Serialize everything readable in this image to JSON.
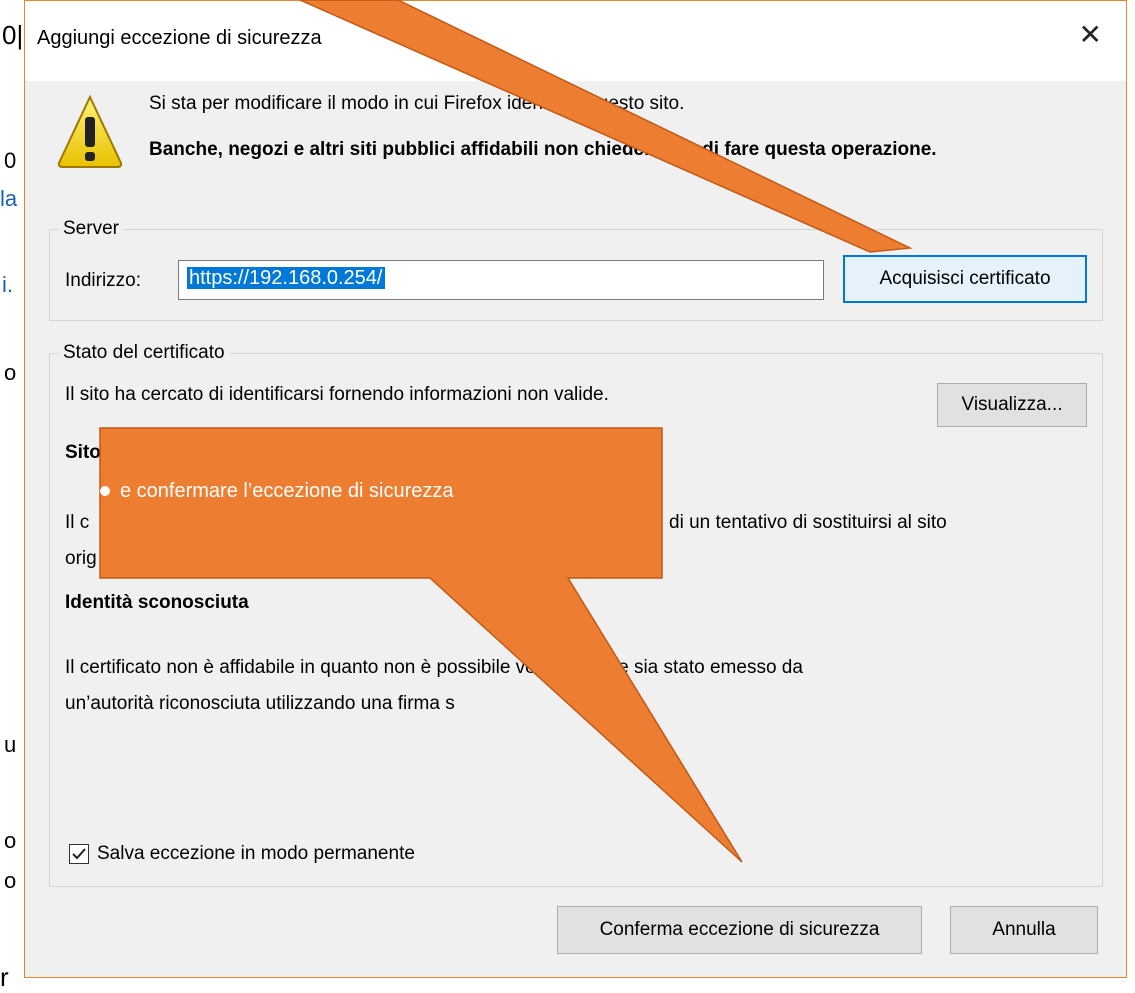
{
  "dialog": {
    "title": "Aggiungi eccezione di sicurezza",
    "warning_line1": "Si sta per modificare il modo in cui Firefox identifica questo sito.",
    "warning_line2": "Banche, negozi e altri siti pubblici affidabili non chiederanno di fare questa operazione.",
    "server": {
      "legend": "Server",
      "address_label": "Indirizzo:",
      "address_value": "https://192.168.0.254/",
      "get_cert_button": "Acquisisci certificato"
    },
    "status": {
      "legend": "Stato del certificato",
      "intro": "Il sito ha cercato di identificarsi fornendo informazioni non valide.",
      "view_button": "Visualizza...",
      "section1_head": "Sito",
      "section1_text_a": "Il c",
      "section1_text_b": "di un tentativo di sostituirsi al sito",
      "section1_text_c": "orig",
      "section2_head": "Identità sconosciuta",
      "section2_line1": "Il certificato non è affidabile in quanto non è possibile verificare che sia stato emesso da",
      "section2_line2": "un’autorità riconosciuta utilizzando una firma s"
    },
    "save_checkbox_label": "Salva eccezione in modo permanente",
    "confirm_button": "Conferma eccezione di sicurezza",
    "cancel_button": "Annulla"
  },
  "callout": {
    "text": "e confermare l’eccezione di sicurezza",
    "color": "#ed7d31"
  },
  "background_fragments": {
    "f1": "0",
    "f2": "la",
    "f3": "i.",
    "f4": "o",
    "f5": "u",
    "f6": "o",
    "f7": "o",
    "bottom": "r"
  }
}
